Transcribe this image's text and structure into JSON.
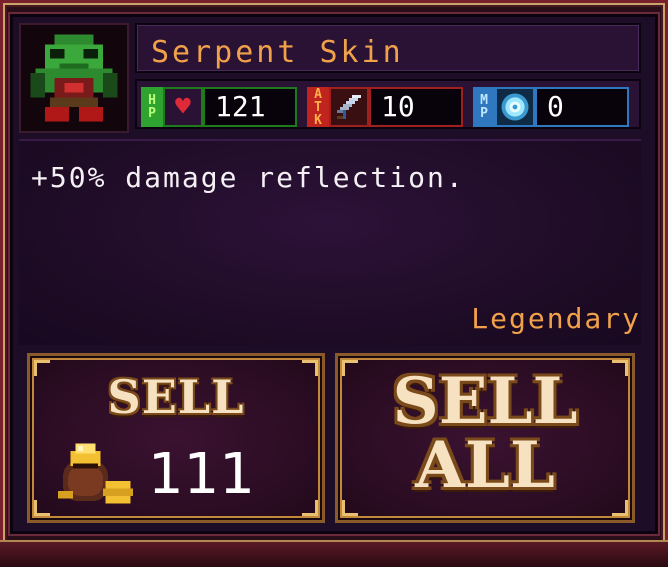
{
  "item": {
    "name": "Serpent Skin",
    "description": "+50% damage reflection.",
    "rarity": "Legendary",
    "portrait_icon": "orc-warrior-portrait"
  },
  "stats": {
    "hp": {
      "tag_top": "H",
      "tag_bottom": "P",
      "icon": "heart-icon",
      "value": "121"
    },
    "atk": {
      "tag_top": "A",
      "tag_mid": "T",
      "tag_bottom": "K",
      "icon": "sword-icon",
      "value": "10"
    },
    "mp": {
      "tag_top": "M",
      "tag_bottom": "P",
      "icon": "mana-orb-icon",
      "value": "0"
    }
  },
  "buttons": {
    "sell": {
      "label": "SELL",
      "price": "111",
      "icon": "gold-bag-icon"
    },
    "sell_all": {
      "line1": "SELL",
      "line2": "ALL"
    }
  },
  "colors": {
    "name": "#f0a14a",
    "rarity": "#f0a14a",
    "hp": "#2fa32f",
    "atk": "#c0241f",
    "mp": "#2f78c0"
  }
}
